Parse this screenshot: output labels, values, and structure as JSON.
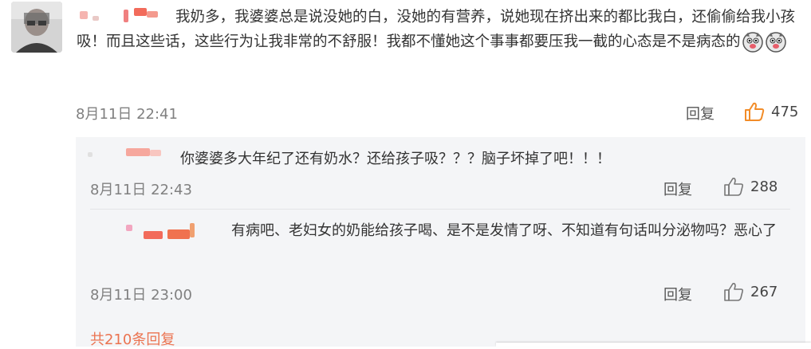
{
  "main_comment": {
    "text": "我奶多，我婆婆总是说没她的白，没她的有营养，说她现在挤出来的都比我白，还偷偷给我小孩吸！而且这些话，这些行为让我非常的不舒服！我都不懂她这个事事都要压我一截的心态是不是病态的",
    "emojis": [
      "doge-emoji",
      "doge-emoji"
    ],
    "timestamp": "8月11日 22:41",
    "reply_label": "回复",
    "like_count": "475",
    "like_icon": "thumbs-up-icon-active",
    "accent_color": "#eb7350"
  },
  "replies": [
    {
      "text": "你婆婆多大年纪了还有奶水？还给孩子吸？？？脑子坏掉了吧！！！",
      "timestamp": "8月11日 22:43",
      "reply_label": "回复",
      "like_count": "288",
      "like_icon": "thumbs-up-icon"
    },
    {
      "text": "有病吧、老妇女的奶能给孩子喝、是不是发情了呀、不知道有句话叫分泌物吗？恶心了",
      "timestamp": "8月11日 23:00",
      "reply_label": "回复",
      "like_count": "267",
      "like_icon": "thumbs-up-icon"
    }
  ],
  "more_replies": "共210条回复"
}
